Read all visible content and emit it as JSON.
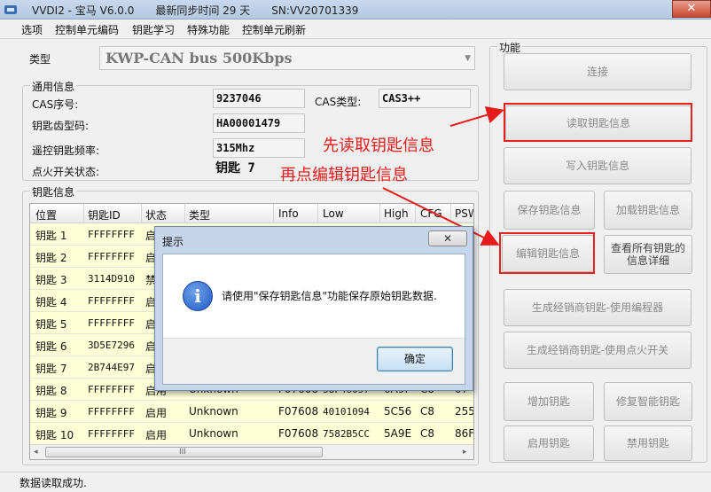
{
  "window": {
    "title": "VVDI2 - 宝马 V6.0.0　　最新同步时间 29 天　　SN:VV20701339",
    "close_glyph": "✕"
  },
  "menu": [
    "选项",
    "控制单元编码",
    "钥匙学习",
    "特殊功能",
    "控制单元刷新"
  ],
  "type_label": "类型",
  "type_value": "KWP-CAN bus 500Kbps",
  "general": {
    "title": "通用信息",
    "cas_serial_label": "CAS序号:",
    "cas_serial": "9237046",
    "cas_type_label": "CAS类型:",
    "cas_type": "CAS3++",
    "key_cut_label": "钥匙齿型码:",
    "key_cut": "HA00001479",
    "remote_freq_label": "遥控钥匙频率:",
    "remote_freq": "315Mhz",
    "ignition_label": "点火开关状态:",
    "ignition": "钥匙 7"
  },
  "key_info": {
    "title": "钥匙信息",
    "columns": [
      "位置",
      "钥匙ID",
      "状态",
      "类型",
      "Info",
      "Low",
      "High",
      "CFG",
      "PSW"
    ],
    "rows": [
      [
        "钥匙 1",
        "FFFFFFFF",
        "启",
        "",
        "",
        "",
        "",
        "",
        ""
      ],
      [
        "钥匙 2",
        "FFFFFFFF",
        "启",
        "",
        "",
        "",
        "",
        "",
        ""
      ],
      [
        "钥匙 3",
        "3114D910",
        "禁",
        "",
        "",
        "",
        "",
        "",
        ""
      ],
      [
        "钥匙 4",
        "FFFFFFFF",
        "启",
        "",
        "",
        "",
        "",
        "",
        ""
      ],
      [
        "钥匙 5",
        "FFFFFFFF",
        "启",
        "",
        "",
        "",
        "",
        "",
        ""
      ],
      [
        "钥匙 6",
        "3D5E7296",
        "启",
        "",
        "",
        "",
        "",
        "",
        ""
      ],
      [
        "钥匙 7",
        "2B744E97",
        "启",
        "",
        "",
        "",
        "",
        "",
        ""
      ],
      [
        "钥匙 8",
        "FFFFFFFF",
        "启用",
        "Unknown",
        "F07608",
        "58F46057",
        "6A9F",
        "C8",
        "07"
      ],
      [
        "钥匙 9",
        "FFFFFFFF",
        "启用",
        "Unknown",
        "F07608",
        "40101094",
        "5C56",
        "C8",
        "255"
      ],
      [
        "钥匙 10",
        "FFFFFFFF",
        "启用",
        "Unknown",
        "F07608",
        "7582B5CC",
        "5A9E",
        "C8",
        "86F"
      ]
    ],
    "scroll_left": "◂",
    "scroll_right": "▸",
    "scroll_grip": "III"
  },
  "functions": {
    "title": "功能",
    "connect": "连接",
    "read_key": "读取钥匙信息",
    "write_key": "写入钥匙信息",
    "save_key": "保存钥匙信息",
    "load_key": "加载钥匙信息",
    "edit_key": "编辑钥匙信息",
    "view_all": "查看所有钥匙的信息详细",
    "dealer_programmer": "生成经销商钥匙-使用编程器",
    "dealer_ignition": "生成经销商钥匙-使用点火开关",
    "add_key": "增加钥匙",
    "repair_key": "修复智能钥匙",
    "enable_key": "启用钥匙",
    "disable_key": "禁用钥匙"
  },
  "annotations": {
    "first": "先读取钥匙信息",
    "second": "再点编辑钥匙信息",
    "color": "#e81a1a"
  },
  "dialog": {
    "title": "提示",
    "close_glyph": "✕",
    "icon_glyph": "i",
    "message": "请使用\"保存钥匙信息\"功能保存原始钥匙数据.",
    "ok": "确定"
  },
  "status": "数据读取成功."
}
